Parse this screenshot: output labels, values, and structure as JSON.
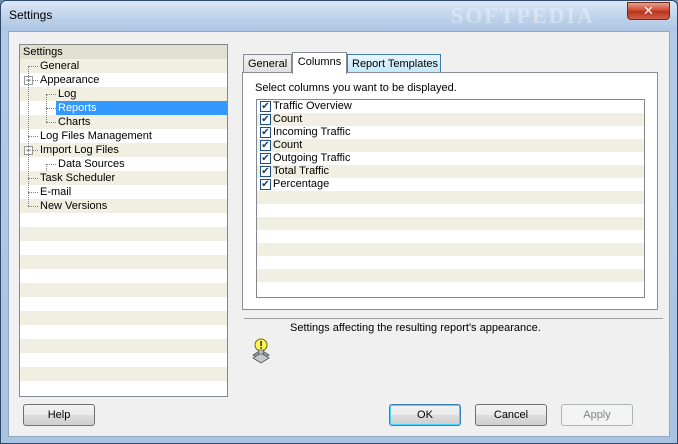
{
  "window": {
    "title": "Settings",
    "close_glyph": "✕",
    "watermark": "SOFTPEDIA"
  },
  "tree": {
    "items": [
      {
        "label": "Settings",
        "level": 0
      },
      {
        "label": "General",
        "level": 1
      },
      {
        "label": "Appearance",
        "level": 1,
        "expander": "−"
      },
      {
        "label": "Log",
        "level": 2
      },
      {
        "label": "Reports",
        "level": 2,
        "selected": true
      },
      {
        "label": "Charts",
        "level": 2
      },
      {
        "label": "Log Files Management",
        "level": 1
      },
      {
        "label": "Import Log Files",
        "level": 1,
        "expander": "−"
      },
      {
        "label": "Data Sources",
        "level": 2
      },
      {
        "label": "Task Scheduler",
        "level": 1
      },
      {
        "label": "E-mail",
        "level": 1
      },
      {
        "label": "New Versions",
        "level": 1
      }
    ]
  },
  "tabs": [
    {
      "label": "General"
    },
    {
      "label": "Columns",
      "active": true
    },
    {
      "label": "Report Templates"
    }
  ],
  "columns_page": {
    "instruction": "Select columns you want to be displayed.",
    "checkmark": "✔",
    "columns": [
      {
        "label": "Traffic Overview",
        "checked": true
      },
      {
        "label": "Count",
        "checked": true
      },
      {
        "label": "Incoming Traffic",
        "checked": true
      },
      {
        "label": "Count",
        "checked": true
      },
      {
        "label": "Outgoing Traffic",
        "checked": true
      },
      {
        "label": "Total Traffic",
        "checked": true
      },
      {
        "label": "Percentage",
        "checked": true
      }
    ]
  },
  "description": "Settings affecting the resulting report's appearance.",
  "buttons": {
    "help": "Help",
    "ok": "OK",
    "cancel": "Cancel",
    "apply": "Apply"
  },
  "colors": {
    "selection": "#3399ff",
    "stripe": "#f1efe2",
    "title_bar": "#bcd1ea",
    "close_button": "#c8432b"
  }
}
